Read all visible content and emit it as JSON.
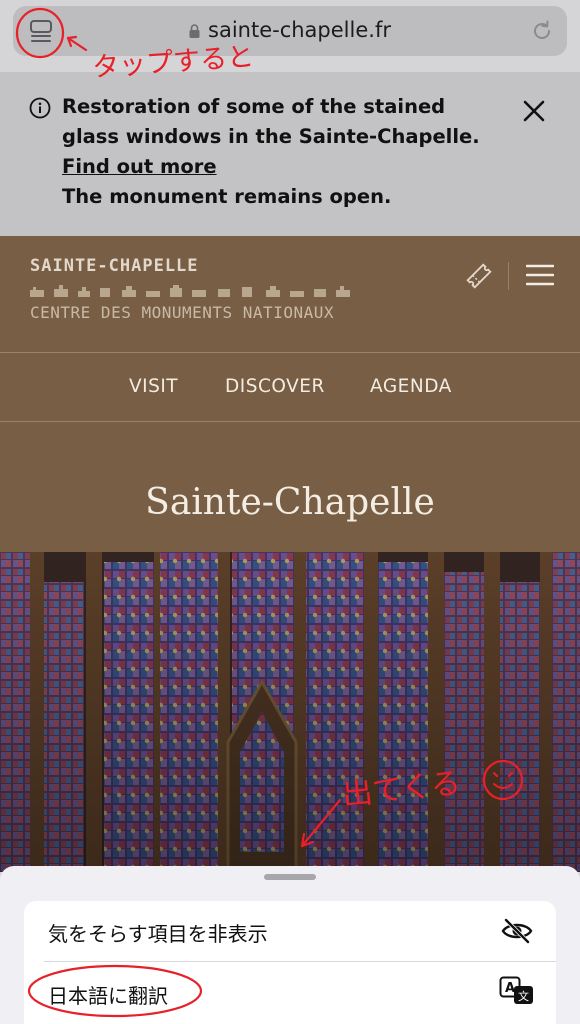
{
  "browser": {
    "url": "sainte-chapelle.fr"
  },
  "banner": {
    "text": "Restoration of some of the stained glass windows in the Sainte-Chapelle.",
    "link_text": "Find out more",
    "note": "The monument remains open."
  },
  "header": {
    "brand_name": "SAINTE-CHAPELLE",
    "brand_sub": "CENTRE DES MONUMENTS NATIONAUX",
    "nav": [
      "VISIT",
      "DISCOVER",
      "AGENDA"
    ],
    "page_title": "Sainte-Chapelle"
  },
  "sheet": {
    "items": [
      {
        "label": "気をそらす項目を非表示",
        "icon": "eye-slash-icon"
      },
      {
        "label": "日本語に翻訳",
        "icon": "translate-icon"
      }
    ]
  },
  "annotations": {
    "tap_note": "タップすると",
    "appear_note": "出てくる"
  },
  "colors": {
    "header_bg": "#775e44",
    "annotation_red": "#e8202a",
    "banner_bg": "#c3c3c5"
  }
}
